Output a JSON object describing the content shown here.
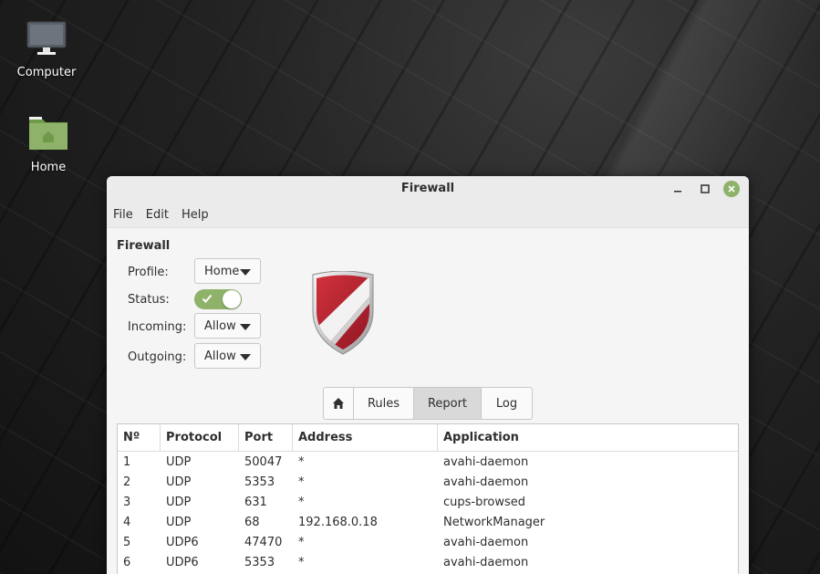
{
  "desktop": {
    "icons": [
      {
        "label": "Computer",
        "icon": "monitor-icon"
      },
      {
        "label": "Home",
        "icon": "home-folder-icon"
      }
    ]
  },
  "window": {
    "title": "Firewall",
    "menu": [
      "File",
      "Edit",
      "Help"
    ],
    "section_title": "Firewall",
    "form": {
      "profile_label": "Profile:",
      "profile_value": "Home",
      "status_label": "Status:",
      "status_on": true,
      "incoming_label": "Incoming:",
      "incoming_value": "Allow",
      "outgoing_label": "Outgoing:",
      "outgoing_value": "Allow"
    },
    "tabs": [
      {
        "label": "",
        "icon": "home-icon"
      },
      {
        "label": "Rules"
      },
      {
        "label": "Report",
        "active": true
      },
      {
        "label": "Log"
      }
    ],
    "report_table": {
      "headers": [
        "Nº",
        "Protocol",
        "Port",
        "Address",
        "Application"
      ],
      "rows": [
        [
          "1",
          "UDP",
          "50047",
          "*",
          "avahi-daemon"
        ],
        [
          "2",
          "UDP",
          "5353",
          "*",
          "avahi-daemon"
        ],
        [
          "3",
          "UDP",
          "631",
          "*",
          "cups-browsed"
        ],
        [
          "4",
          "UDP",
          "68",
          "192.168.0.18",
          "NetworkManager"
        ],
        [
          "5",
          "UDP6",
          "47470",
          "*",
          "avahi-daemon"
        ],
        [
          "6",
          "UDP6",
          "5353",
          "*",
          "avahi-daemon"
        ]
      ]
    }
  },
  "colors": {
    "accent": "#8fb26a",
    "shield_red": "#b01f2e"
  }
}
